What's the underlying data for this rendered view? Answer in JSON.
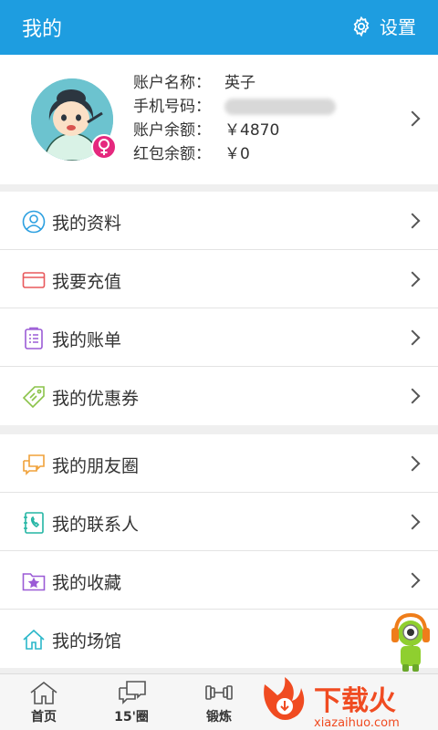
{
  "header": {
    "title": "我的",
    "settings_label": "设置",
    "icon": "gear-icon"
  },
  "profile": {
    "rows": [
      {
        "label": "账户名称：",
        "value": "英子"
      },
      {
        "label": "手机号码：",
        "value": ""
      },
      {
        "label": "账户余额：",
        "value": "￥4870"
      },
      {
        "label": "红包余额：",
        "value": "￥0"
      }
    ],
    "gender_symbol": "♀"
  },
  "menu_group_1": [
    {
      "label": "我的资料",
      "icon": "user-icon",
      "color": "#2b9fe0"
    },
    {
      "label": "我要充值",
      "icon": "card-icon",
      "color": "#e8585b"
    },
    {
      "label": "我的账单",
      "icon": "clipboard-icon",
      "color": "#9b5bd6"
    },
    {
      "label": "我的优惠券",
      "icon": "tag-icon",
      "color": "#8bc34a"
    }
  ],
  "menu_group_2": [
    {
      "label": "我的朋友圈",
      "icon": "chat-icon",
      "color": "#f0a23a"
    },
    {
      "label": "我的联系人",
      "icon": "contacts-icon",
      "color": "#23b5a4"
    },
    {
      "label": "我的收藏",
      "icon": "folder-star-icon",
      "color": "#9b5bd6"
    },
    {
      "label": "我的场馆",
      "icon": "home-icon",
      "color": "#2bb7c9"
    }
  ],
  "tabs": [
    {
      "label": "首页",
      "icon": "home-icon"
    },
    {
      "label": "15'圈",
      "icon": "chat-icon"
    },
    {
      "label": "锻炼",
      "icon": "dumbbell-icon"
    }
  ],
  "watermark": {
    "text": "下载火",
    "url": "xiazaihuo.com"
  }
}
